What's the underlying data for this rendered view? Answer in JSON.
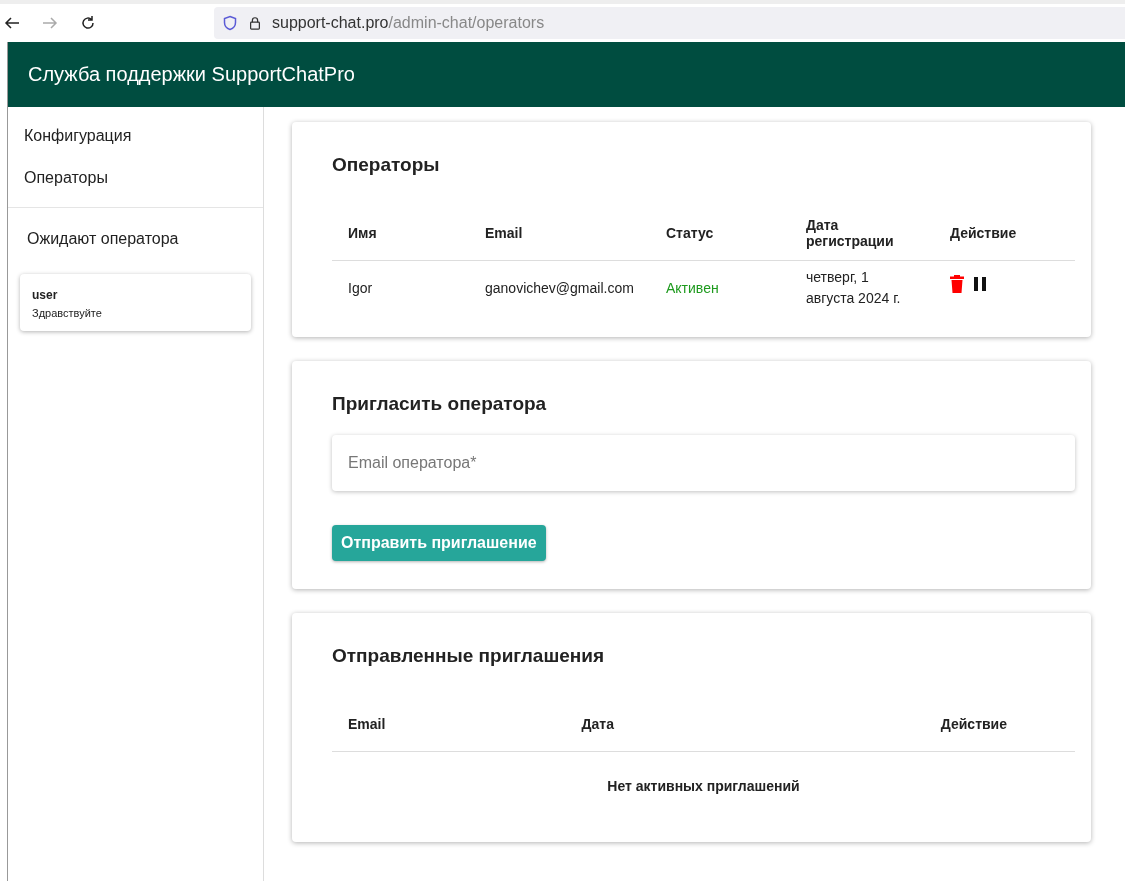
{
  "browser": {
    "url_host": "support-chat.pro",
    "url_path": "/admin-chat/operators"
  },
  "header": {
    "title": "Служба поддержки SupportChatPro"
  },
  "sidebar": {
    "items": [
      {
        "label": "Конфигурация"
      },
      {
        "label": "Операторы"
      }
    ],
    "waiting_title": "Ожидают оператора",
    "chats": [
      {
        "name": "user",
        "message": "Здравствуйте"
      }
    ]
  },
  "operators": {
    "title": "Операторы",
    "columns": [
      "Имя",
      "Email",
      "Статус",
      "Дата регистрации",
      "Действие"
    ],
    "rows": [
      {
        "name": "Igor",
        "email": "ganovichev@gmail.com",
        "status": "Активен",
        "active": true,
        "date": "четверг, 1 августа 2024 г."
      }
    ]
  },
  "invite": {
    "title": "Пригласить оператора",
    "placeholder": "Email оператора*",
    "button": "Отправить приглашение"
  },
  "sent": {
    "title": "Отправленные приглашения",
    "columns": [
      "Email",
      "Дата",
      "Действие"
    ],
    "empty": "Нет активных приглашений"
  }
}
